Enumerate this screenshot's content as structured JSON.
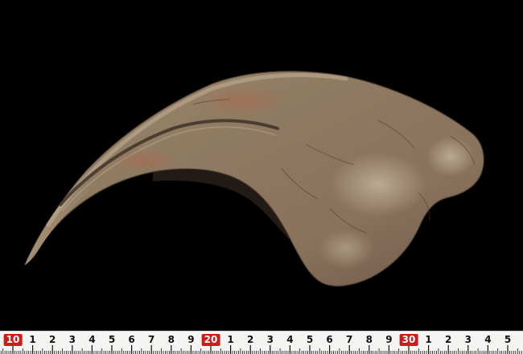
{
  "photo": {
    "subject": "fossil-claw",
    "background_color": "#000000",
    "fossil_colors": {
      "base": "#8a7660",
      "light": "#b8a58c",
      "dark": "#4a3e32",
      "reddish": "#9c6e55"
    }
  },
  "ruler": {
    "background_color": "#f4f4f2",
    "major_label_color": "#d11a1a",
    "tick_color": "#111111",
    "labels": [
      {
        "text": "10",
        "major": true
      },
      {
        "text": "1",
        "major": false
      },
      {
        "text": "2",
        "major": false
      },
      {
        "text": "3",
        "major": false
      },
      {
        "text": "4",
        "major": false
      },
      {
        "text": "5",
        "major": false
      },
      {
        "text": "6",
        "major": false
      },
      {
        "text": "7",
        "major": false
      },
      {
        "text": "8",
        "major": false
      },
      {
        "text": "9",
        "major": false
      },
      {
        "text": "20",
        "major": true
      },
      {
        "text": "1",
        "major": false
      },
      {
        "text": "2",
        "major": false
      },
      {
        "text": "3",
        "major": false
      },
      {
        "text": "4",
        "major": false
      },
      {
        "text": "5",
        "major": false
      },
      {
        "text": "6",
        "major": false
      },
      {
        "text": "7",
        "major": false
      },
      {
        "text": "8",
        "major": false
      },
      {
        "text": "9",
        "major": false
      },
      {
        "text": "30",
        "major": true
      },
      {
        "text": "1",
        "major": false
      },
      {
        "text": "2",
        "major": false
      },
      {
        "text": "3",
        "major": false
      },
      {
        "text": "4",
        "major": false
      },
      {
        "text": "5",
        "major": false
      }
    ]
  }
}
